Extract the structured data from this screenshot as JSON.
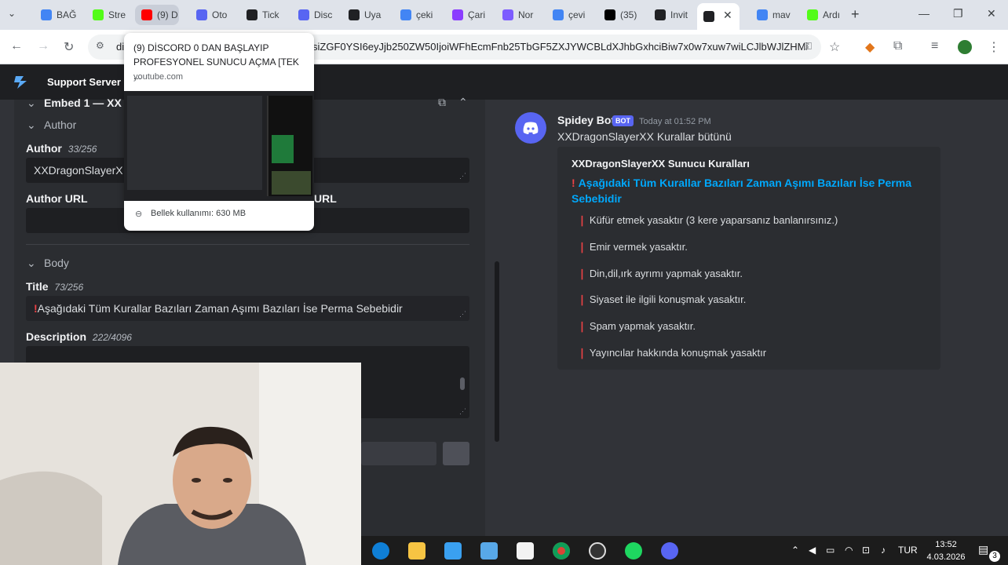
{
  "browser": {
    "tabs": [
      {
        "label": "BAĞ",
        "icon": "google-docs-icon",
        "color": "#4285f4"
      },
      {
        "label": "Stre",
        "icon": "kick-icon",
        "color": "#53fc18"
      },
      {
        "label": "(9) D",
        "icon": "youtube-icon",
        "color": "#ff0000"
      },
      {
        "label": "Oto",
        "icon": "discord-bot-icon",
        "color": "#5865f2"
      },
      {
        "label": "Tick",
        "icon": "ticket-icon",
        "color": "#202124"
      },
      {
        "label": "Disc",
        "icon": "discord-icon",
        "color": "#5865f2"
      },
      {
        "label": "Uya",
        "icon": "shield-icon",
        "color": "#202124"
      },
      {
        "label": "çeki",
        "icon": "google-icon",
        "color": "#4285f4"
      },
      {
        "label": "Çari",
        "icon": "canva-icon",
        "color": "#8b3dff"
      },
      {
        "label": "Nor",
        "icon": "norton-icon",
        "color": "#7d5cff"
      },
      {
        "label": "çevi",
        "icon": "google-icon",
        "color": "#4285f4"
      },
      {
        "label": "(35)",
        "icon": "tiktok-icon",
        "color": "#000000"
      },
      {
        "label": "Invit",
        "icon": "invite-icon",
        "color": "#202124"
      },
      {
        "label": "",
        "icon": "spidey-bot-icon",
        "color": "#202124"
      },
      {
        "label": "mav",
        "icon": "google-icon",
        "color": "#4285f4"
      },
      {
        "label": "Ardı",
        "icon": "kick-icon",
        "color": "#53fc18"
      }
    ],
    "address_host": "di",
    "address_url": "siZGF0YSI6eyJjb250ZW50IjoiWFhEcmFnb25TbGF5ZXJYWCBLdXJhbGxhciBiw7x0w7xuw7wiLCJlbWJlZHMi..."
  },
  "hover_card": {
    "title": "(9) DİSCORD 0 DAN BAŞLAYIP PROFESYONEL SUNUCU AÇMA [TEK ...",
    "domain": "youtube.com",
    "memory": "Bellek kullanımı: 630 MB"
  },
  "app": {
    "server_name": "Support Server",
    "editor": {
      "embed_header": "Embed 1 — XX",
      "author_section": "Author",
      "author_label": "Author",
      "author_count": "33/256",
      "author_value": "XXDragonSlayerX",
      "author_url_label": "Author URL",
      "author_url_label_right": "URL",
      "body_section": "Body",
      "title_label": "Title",
      "title_count": "73/256",
      "title_value": "Aşağıdaki Tüm Kurallar Bazıları Zaman Aşımı Bazıları İse Perma Sebebidir",
      "description_label": "Description",
      "description_count": "222/4096"
    },
    "message": {
      "author": "Spidey Bot",
      "bot_tag": "BOT",
      "timestamp": "Today at 01:52 PM",
      "content": "XXDragonSlayerXX Kurallar bütünü",
      "embed": {
        "author": "XXDragonSlayerXX Sunucu Kuralları",
        "title": "Aşağıdaki Tüm Kurallar Bazıları Zaman Aşımı Bazıları İse Perma Sebebidir",
        "rules": [
          "Küfür etmek yasaktır (3 kere yaparsanız banlanırsınız.)",
          "Emir vermek yasaktır.",
          "Din,dil,ırk ayrımı yapmak yasaktır.",
          "Siyaset ile ilgili konuşmak yasaktır.",
          "Spam yapmak yasaktır.",
          "Yayıncılar hakkında konuşmak yasaktır"
        ]
      }
    }
  },
  "taskbar": {
    "language": "TUR",
    "time": "13:52",
    "date": "4.03.2026",
    "notifications": "3"
  }
}
